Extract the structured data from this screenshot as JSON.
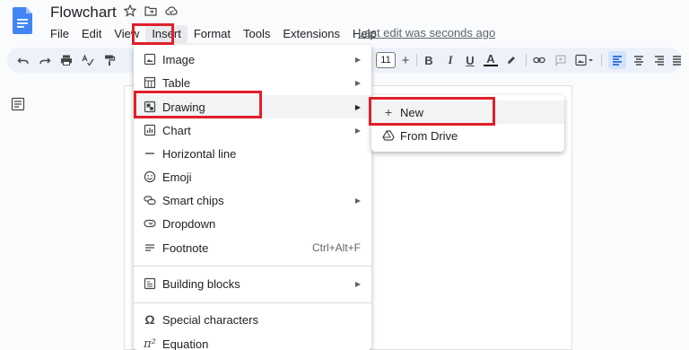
{
  "app": {
    "title": "Flowchart",
    "last_edit": "Last edit was seconds ago"
  },
  "menubar": [
    "File",
    "Edit",
    "View",
    "Insert",
    "Format",
    "Tools",
    "Extensions",
    "Help"
  ],
  "toolbar": {
    "font_size": "11",
    "bold": "B",
    "italic": "I",
    "underline": "U",
    "text_color": "A"
  },
  "insert_menu": {
    "items": [
      {
        "label": "Image",
        "icon": "image-icon",
        "submenu": true
      },
      {
        "label": "Table",
        "icon": "table-icon",
        "submenu": true
      },
      {
        "label": "Drawing",
        "icon": "drawing-icon",
        "submenu": true
      },
      {
        "label": "Chart",
        "icon": "chart-icon",
        "submenu": true
      },
      {
        "label": "Horizontal line",
        "icon": "horizontal-line-icon"
      },
      {
        "label": "Emoji",
        "icon": "emoji-icon"
      },
      {
        "label": "Smart chips",
        "icon": "smart-chips-icon",
        "submenu": true
      },
      {
        "label": "Dropdown",
        "icon": "dropdown-icon"
      },
      {
        "label": "Footnote",
        "icon": "footnote-icon",
        "shortcut": "Ctrl+Alt+F"
      },
      {
        "label": "Building blocks",
        "icon": "building-blocks-icon",
        "submenu": true
      },
      {
        "label": "Special characters",
        "icon": "omega-icon"
      },
      {
        "label": "Equation",
        "icon": "pi-icon"
      }
    ]
  },
  "drawing_submenu": {
    "items": [
      {
        "label": "New",
        "icon": "plus-icon"
      },
      {
        "label": "From Drive",
        "icon": "drive-icon"
      }
    ]
  },
  "colors": {
    "accent": "#1a73e8",
    "highlight": "#e0202a",
    "doc_blue": "#4285f4"
  }
}
